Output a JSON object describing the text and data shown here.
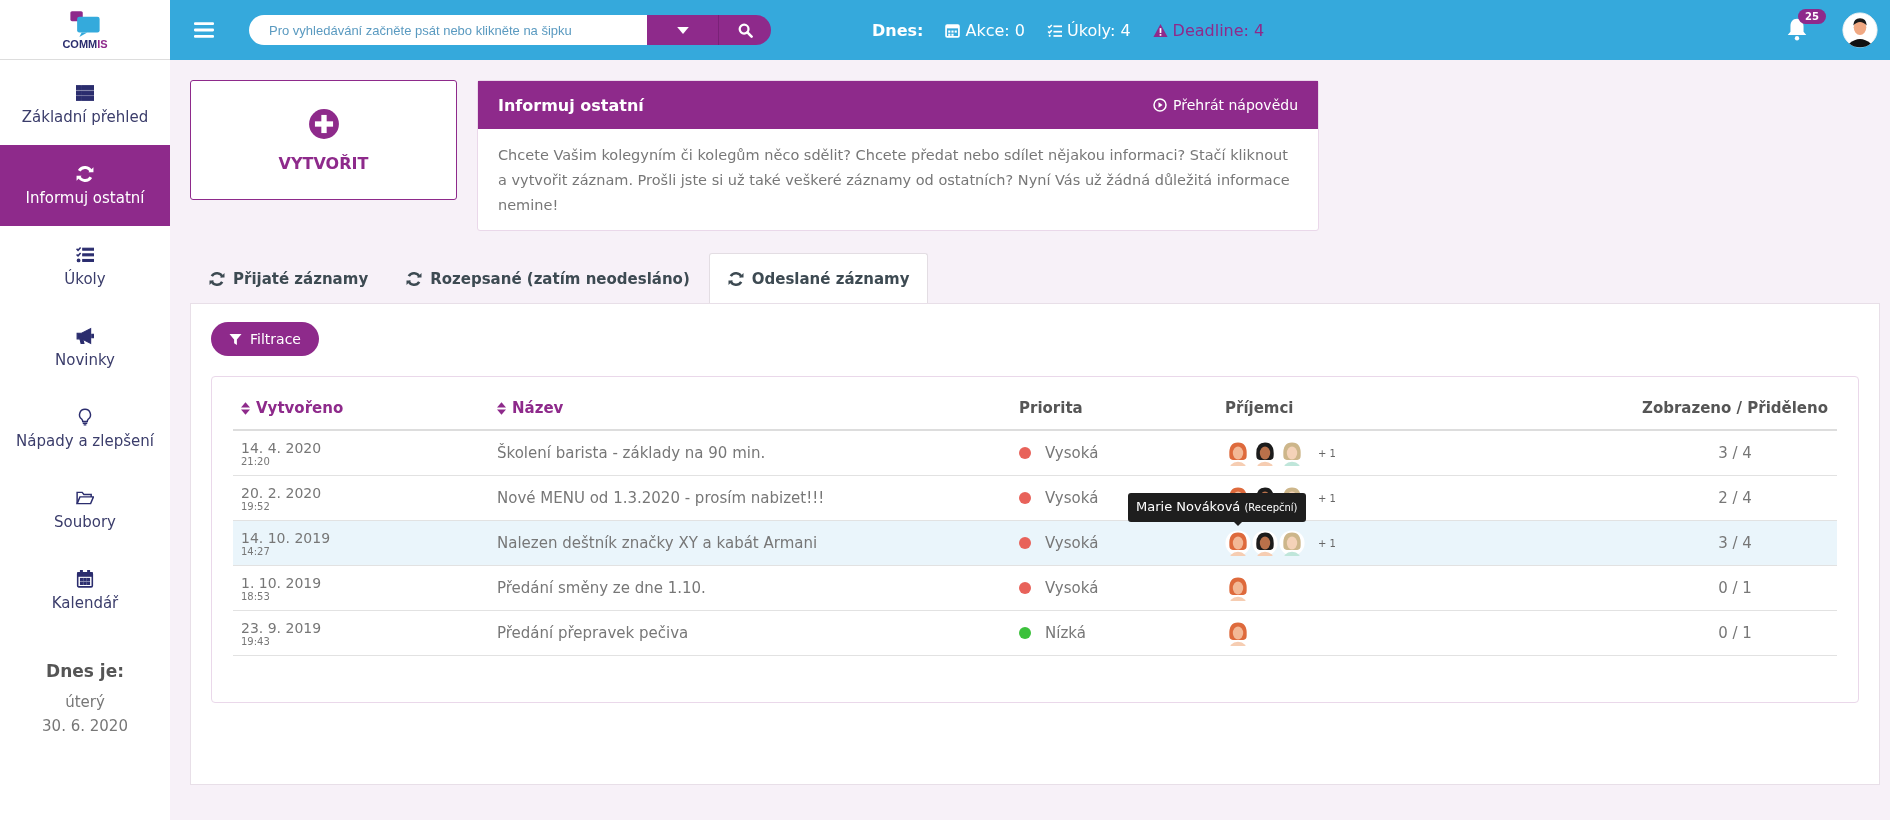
{
  "logo": {
    "text": "COMM",
    "accent": "IS"
  },
  "search": {
    "placeholder": "Pro vyhledávání začněte psát nebo klikněte na šipku"
  },
  "today_bar": {
    "label": "Dnes:",
    "items": [
      {
        "kind": "events",
        "text": "Akce: 0"
      },
      {
        "kind": "tasks",
        "text": "Úkoly: 4"
      },
      {
        "kind": "deadline",
        "text": "Deadline: 4"
      }
    ]
  },
  "notifications": {
    "count": "25"
  },
  "sidebar": {
    "items": [
      {
        "label": "Základní přehled",
        "selected": false
      },
      {
        "label": "Informuj ostatní",
        "selected": true
      },
      {
        "label": "Úkoly",
        "selected": false
      },
      {
        "label": "Novinky",
        "selected": false
      },
      {
        "label": "Nápady a zlepšení",
        "selected": false
      },
      {
        "label": "Soubory",
        "selected": false
      },
      {
        "label": "Kalendář",
        "selected": false
      }
    ],
    "today": {
      "title": "Dnes je:",
      "weekday": "úterý",
      "date": "30. 6. 2020"
    }
  },
  "create_card": {
    "label": "VYTVOŘIT"
  },
  "info_card": {
    "title": "Informuj ostatní",
    "help_link": "Přehrát nápovědu",
    "text": "Chcete Vašim kolegyním či kolegům něco sdělit? Chcete předat nebo sdílet nějakou informaci? Stačí kliknout a vytvořit záznam. Prošli jste si už také veškeré záznamy od ostatních? Nyní Vás už žádná důležitá informace nemine!"
  },
  "tabs": [
    {
      "label": "Přijaté záznamy",
      "selected": false
    },
    {
      "label": "Rozepsané (zatím neodesláno)",
      "selected": false
    },
    {
      "label": "Odeslané záznamy",
      "selected": true
    }
  ],
  "filter_button": {
    "label": "Filtrace"
  },
  "table": {
    "columns": [
      {
        "label": "Vytvořeno",
        "sortable": true
      },
      {
        "label": "Název",
        "sortable": true
      },
      {
        "label": "Priorita",
        "sortable": false
      },
      {
        "label": "Příjemci",
        "sortable": false
      },
      {
        "label": "Zobrazeno / Přiděleno",
        "sortable": false
      }
    ],
    "rows": [
      {
        "date": "14. 4. 2020",
        "time": "21:20",
        "title": "Školení barista - základy na 90 min.",
        "priority": {
          "text": "Vysoká",
          "color": "#e8625a"
        },
        "recipients": [
          {
            "kind": "redhead"
          },
          {
            "kind": "curly"
          },
          {
            "kind": "glasses"
          }
        ],
        "extra": "+ 1",
        "seen": "3 / 4",
        "selected": false
      },
      {
        "date": "20. 2. 2020",
        "time": "19:52",
        "title": "Nové MENU od 1.3.2020 - prosím nabizet!!!",
        "priority": {
          "text": "Vysoká",
          "color": "#e8625a"
        },
        "recipients": [
          {
            "kind": "redhead"
          },
          {
            "kind": "curly"
          },
          {
            "kind": "glasses"
          }
        ],
        "extra": "+ 1",
        "seen": "2 / 4",
        "selected": false
      },
      {
        "date": "14. 10. 2019",
        "time": "14:27",
        "title": "Nalezen deštník značky XY a kabát Armani",
        "priority": {
          "text": "Vysoká",
          "color": "#e8625a"
        },
        "recipients": [
          {
            "kind": "redhead"
          },
          {
            "kind": "curly"
          },
          {
            "kind": "glasses"
          }
        ],
        "extra": "+ 1",
        "seen": "3 / 4",
        "selected": true,
        "tooltip": {
          "name": "Marie Nováková",
          "role": "(Recepční)"
        }
      },
      {
        "date": "1. 10. 2019",
        "time": "18:53",
        "title": "Předání směny ze dne 1.10.",
        "priority": {
          "text": "Vysoká",
          "color": "#e8625a"
        },
        "recipients": [
          {
            "kind": "redhead"
          }
        ],
        "seen": "0 / 1",
        "selected": false
      },
      {
        "date": "23. 9. 2019",
        "time": "19:43",
        "title": "Předání přepravek pečiva",
        "priority": {
          "text": "Nízká",
          "color": "#3cc13c"
        },
        "recipients": [
          {
            "kind": "redhead"
          }
        ],
        "seen": "0 / 1",
        "selected": false
      }
    ]
  }
}
